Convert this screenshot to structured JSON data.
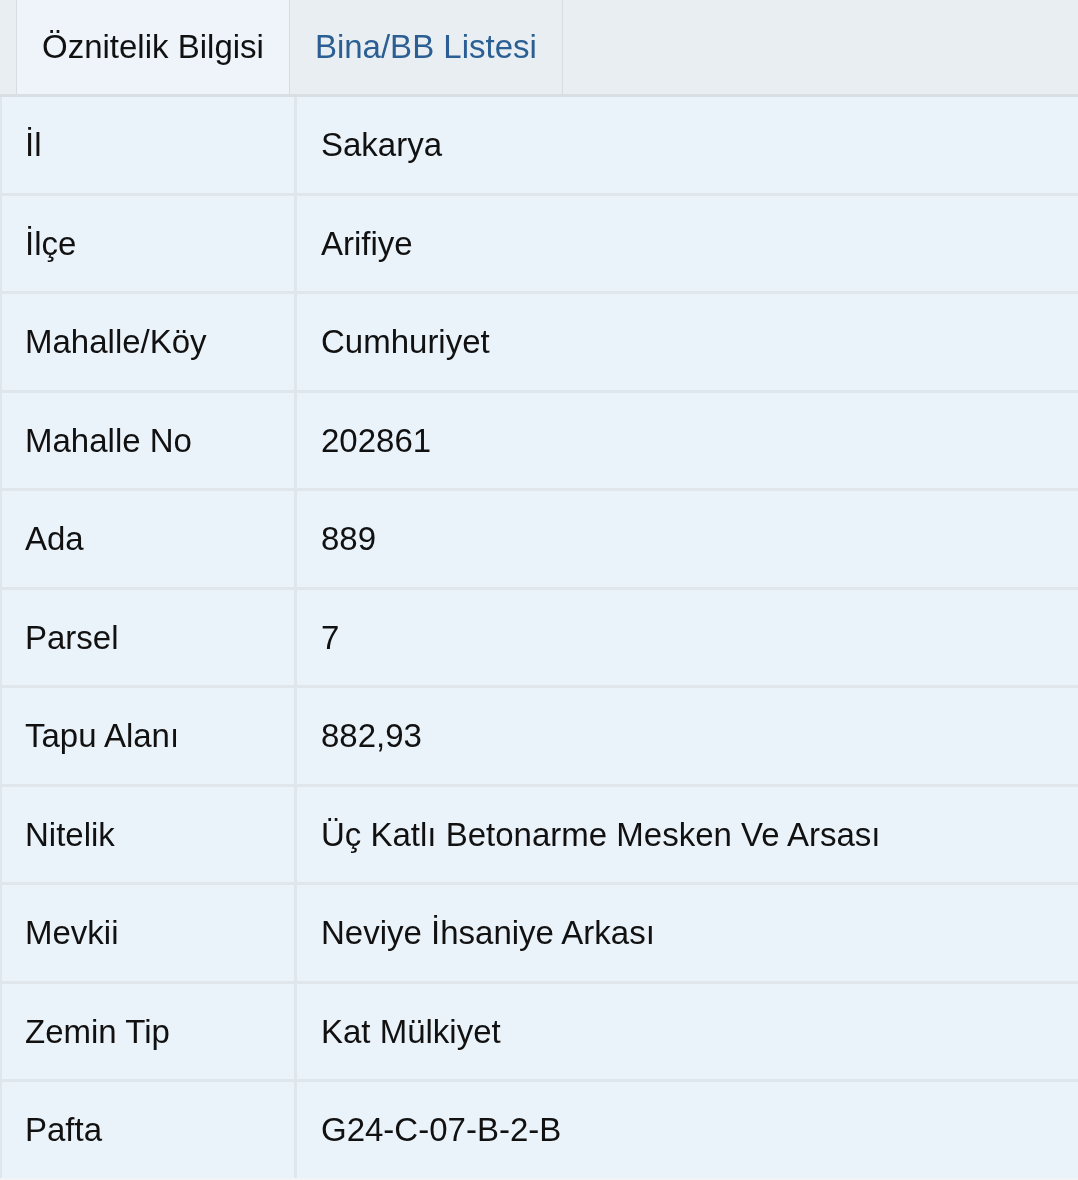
{
  "tabs": [
    {
      "label": "Öznitelik Bilgisi",
      "selected": true
    },
    {
      "label": "Bina/BB Listesi",
      "selected": false
    }
  ],
  "table": {
    "rows": [
      {
        "label": "İl",
        "value": "Sakarya"
      },
      {
        "label": "İlçe",
        "value": "Arifiye"
      },
      {
        "label": "Mahalle/Köy",
        "value": "Cumhuriyet"
      },
      {
        "label": "Mahalle No",
        "value": "202861"
      },
      {
        "label": "Ada",
        "value": "889"
      },
      {
        "label": "Parsel",
        "value": "7"
      },
      {
        "label": "Tapu Alanı",
        "value": "882,93"
      },
      {
        "label": "Nitelik",
        "value": "Üç Katlı Betonarme Mesken Ve Arsası"
      },
      {
        "label": "Mevkii",
        "value": "Neviye İhsaniye Arkası"
      },
      {
        "label": "Zemin Tip",
        "value": "Kat Mülkiyet"
      },
      {
        "label": "Pafta",
        "value": "G24-C-07-B-2-B"
      }
    ]
  }
}
